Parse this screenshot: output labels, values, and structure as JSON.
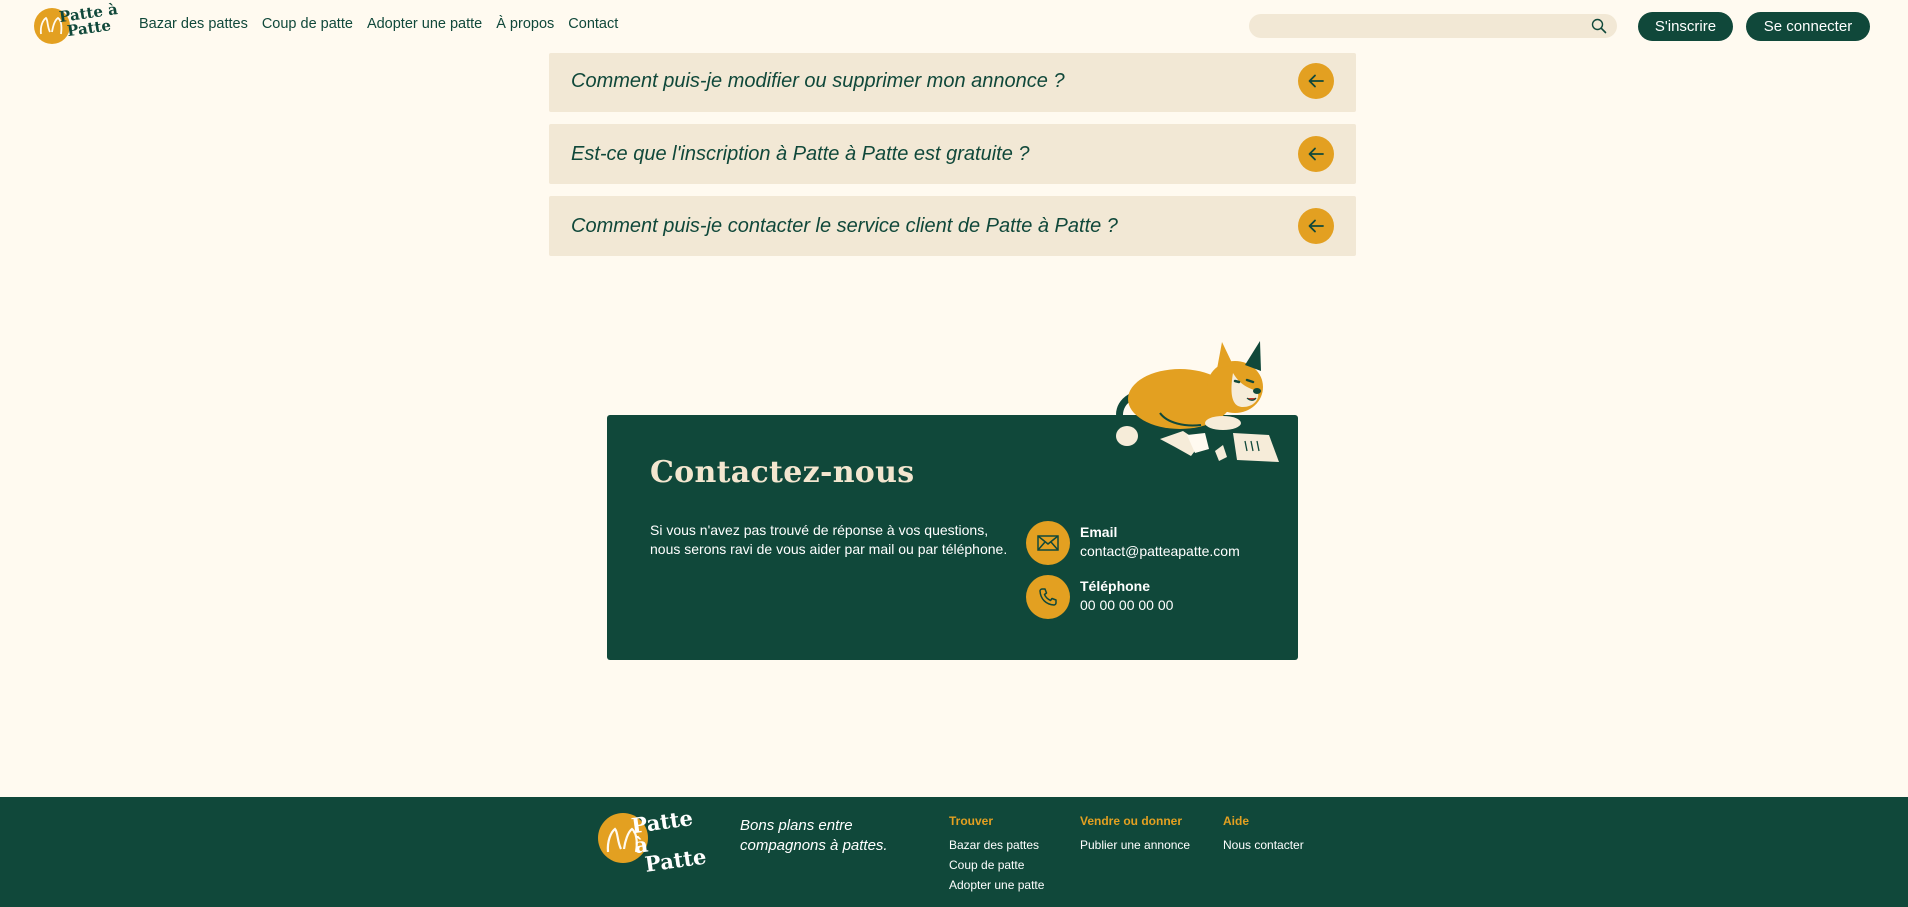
{
  "brand": {
    "name_line1": "Patte à",
    "name_line2": "Patte"
  },
  "nav": {
    "items": [
      "Bazar des pattes",
      "Coup de patte",
      "Adopter une patte",
      "À propos",
      "Contact"
    ]
  },
  "search": {
    "value": "",
    "icon": "search-icon"
  },
  "auth": {
    "signup_label": "S'inscrire",
    "login_label": "Se connecter"
  },
  "faq": {
    "items": [
      {
        "question": "Comment puis-je modifier ou supprimer mon annonce ?"
      },
      {
        "question": "Est-ce que l'inscription à Patte à Patte est gratuite ?"
      },
      {
        "question": "Comment puis-je contacter le service client de Patte à Patte ?"
      }
    ],
    "toggle_icon": "arrow-left-icon"
  },
  "contact": {
    "title": "Contactez-nous",
    "description": "Si vous n'avez pas trouvé de réponse à vos questions, nous serons ravi de vous aider par mail ou par téléphone.",
    "email_label": "Email",
    "email_value": "contact@patteapatte.com",
    "phone_label": "Téléphone",
    "phone_value": "00 00 00 00 00"
  },
  "footer": {
    "slogan": "Bons plans entre compagnons à pattes.",
    "columns": [
      {
        "title": "Trouver",
        "links": [
          "Bazar des pattes",
          "Coup de patte",
          "Adopter une patte"
        ]
      },
      {
        "title": "Vendre ou donner",
        "links": [
          "Publier une annonce"
        ]
      },
      {
        "title": "Aide",
        "links": [
          "Nous contacter"
        ]
      }
    ]
  },
  "colors": {
    "background": "#fffaf0",
    "primary": "#10483a",
    "accent": "#e3a021",
    "faq_bg": "#f2e8d5"
  }
}
